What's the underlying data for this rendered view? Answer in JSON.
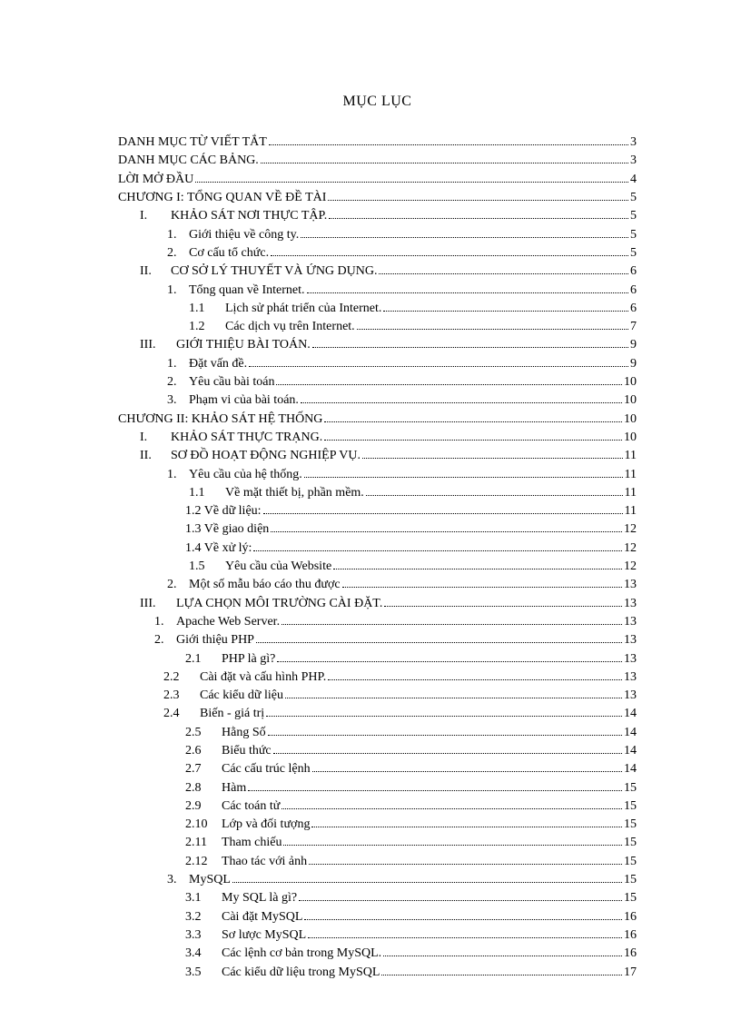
{
  "title": "MỤC LỤC",
  "entries": [
    {
      "indent": "ind0",
      "num": "",
      "text": "DANH MỤC TỪ VIẾT TẮT",
      "page": "3"
    },
    {
      "indent": "ind0",
      "num": "",
      "text": "DANH MỤC CÁC BẢNG.",
      "page": "3"
    },
    {
      "indent": "ind0",
      "num": "",
      "text": "LỜI MỞ ĐẦU",
      "page": "4"
    },
    {
      "indent": "ind0",
      "num": "",
      "text": "CHƯƠNG I: TỔNG QUAN VỀ ĐỀ TÀI",
      "page": "5"
    },
    {
      "indent": "ind1",
      "num": "I.",
      "numClass": "num-pad",
      "text": "KHẢO SÁT NƠI THỰC TẬP.",
      "page": "5"
    },
    {
      "indent": "ind2",
      "num": "1.",
      "numClass": "num-pad-s",
      "text": "Giới thiệu về công ty.",
      "page": "5"
    },
    {
      "indent": "ind2",
      "num": "2.",
      "numClass": "num-pad-s",
      "text": "Cơ cấu tổ chức.",
      "page": "5"
    },
    {
      "indent": "ind1",
      "num": "II.",
      "numClass": "num-pad",
      "text": "CƠ SỞ LÝ THUYẾT  VÀ ỨNG DỤNG.",
      "page": "6"
    },
    {
      "indent": "ind2",
      "num": "1.",
      "numClass": "num-pad-s",
      "text": "Tổng quan về Internet.",
      "page": "6"
    },
    {
      "indent": "ind3",
      "num": "1.1",
      "numClass": "num-pad-ss",
      "text": "Lịch  sử phát triển  của Internet.",
      "page": "6"
    },
    {
      "indent": "ind3",
      "num": "1.2",
      "numClass": "num-pad-ss",
      "text": "Các dịch vụ trên Internet.",
      "page": "7"
    },
    {
      "indent": "ind1",
      "num": "III.",
      "numClass": "num-pad-ss",
      "text": "GIỚI THIỆU BÀI TOÁN.",
      "page": "9"
    },
    {
      "indent": "ind2",
      "num": "1.",
      "numClass": "num-pad-s",
      "text": "Đặt vấn đề.",
      "page": "9"
    },
    {
      "indent": "ind2",
      "num": "2.",
      "numClass": "num-pad-s",
      "text": "Yêu cầu bài toán",
      "page": "10"
    },
    {
      "indent": "ind2",
      "num": "3.",
      "numClass": "num-pad-s",
      "text": "Phạm vi của bài toán.",
      "page": "10"
    },
    {
      "indent": "ind0",
      "num": "",
      "text": "CHƯƠNG II: KHẢO SÁT HỆ THỐNG",
      "page": "10"
    },
    {
      "indent": "ind1",
      "num": "I.",
      "numClass": "num-pad",
      "text": "KHẢO SÁT THỰC TRẠNG.",
      "page": "10"
    },
    {
      "indent": "ind1",
      "num": "II.",
      "numClass": "num-pad",
      "text": "SƠ ĐỒ HOẠT ĐỘNG NGHIỆP VỤ.",
      "page": "11"
    },
    {
      "indent": "ind2",
      "num": "1.",
      "numClass": "num-pad-s",
      "text": "Yêu cầu của hệ thống.",
      "page": "11"
    },
    {
      "indent": "ind3",
      "num": "1.1",
      "numClass": "num-pad-ss",
      "text": "Về mặt thiết bị, phần mềm.",
      "page": "11"
    },
    {
      "indent": "ind3b",
      "num": "",
      "text": "1.2 Về dữ liệu:",
      "page": "11"
    },
    {
      "indent": "ind3b",
      "num": "",
      "text": "1.3 Về giao diện",
      "page": "12"
    },
    {
      "indent": "ind3b",
      "num": "",
      "text": "1.4 Về xử lý:",
      "page": "12"
    },
    {
      "indent": "ind3",
      "num": "1.5",
      "numClass": "num-pad-ss",
      "text": "Yêu cầu của Website",
      "page": "12"
    },
    {
      "indent": "ind2",
      "num": "2.",
      "numClass": "num-pad-s",
      "text": "Một số mẫu báo cáo thu được",
      "page": "13"
    },
    {
      "indent": "ind1",
      "num": "III.",
      "numClass": "num-pad-ss",
      "text": "LỰA CHỌN MÔI TRƯỜNG CÀI ĐẶT.",
      "page": "13"
    },
    {
      "indent": "ind2b",
      "num": "1.",
      "numClass": "num-pad-s",
      "text": "Apache Web Server.",
      "page": "13"
    },
    {
      "indent": "ind2b",
      "num": "2.",
      "numClass": "num-pad-s",
      "text": "Giới thiệu PHP",
      "page": "13"
    },
    {
      "indent": "ind3b",
      "num": "2.1",
      "numClass": "num-pad-ss",
      "text": "PHP là gì?",
      "page": "13"
    },
    {
      "indent": "ind2c",
      "num": "2.2",
      "numClass": "num-pad-ss",
      "text": "Cài đặt và cấu hình  PHP.",
      "page": "13"
    },
    {
      "indent": "ind2c",
      "num": "2.3",
      "numClass": "num-pad-ss",
      "text": "Các kiểu  dữ liệu",
      "page": "13"
    },
    {
      "indent": "ind2c",
      "num": "2.4",
      "numClass": "num-pad-ss",
      "text": "Biến  - giá trị",
      "page": "14"
    },
    {
      "indent": "ind3b",
      "num": "2.5",
      "numClass": "num-pad-ss",
      "text": "Hằng Số",
      "page": "14"
    },
    {
      "indent": "ind3b",
      "num": "2.6",
      "numClass": "num-pad-ss",
      "text": "Biểu thức",
      "page": "14"
    },
    {
      "indent": "ind3b",
      "num": "2.7",
      "numClass": "num-pad-ss",
      "text": "Các cấu trúc lệnh",
      "page": "14"
    },
    {
      "indent": "ind3b",
      "num": "2.8",
      "numClass": "num-pad-ss",
      "text": "Hàm",
      "page": "15"
    },
    {
      "indent": "ind3b",
      "num": "2.9",
      "numClass": "num-pad-ss",
      "text": "Các toán tử",
      "page": "15"
    },
    {
      "indent": "ind3b",
      "num": "2.10",
      "numClass": "num-pad-ss",
      "text": "Lớp và đối tượng",
      "page": "15"
    },
    {
      "indent": "ind3b",
      "num": "2.11",
      "numClass": "num-pad-ss",
      "text": "Tham chiếu",
      "page": "15"
    },
    {
      "indent": "ind3b",
      "num": "2.12",
      "numClass": "num-pad-ss",
      "text": "Thao tác với ảnh",
      "page": "15"
    },
    {
      "indent": "ind2",
      "num": "3.",
      "numClass": "num-pad-s",
      "text": "MySQL",
      "page": "15"
    },
    {
      "indent": "ind3b",
      "num": "3.1",
      "numClass": "num-pad-ss",
      "text": "My SQL là gì?",
      "page": "15"
    },
    {
      "indent": "ind3b",
      "num": "3.2",
      "numClass": "num-pad-ss",
      "text": "Cài đặt MySQL",
      "page": "16"
    },
    {
      "indent": "ind3b",
      "num": "3.3",
      "numClass": "num-pad-ss",
      "text": "Sơ lược MySQL",
      "page": "16"
    },
    {
      "indent": "ind3b",
      "num": "3.4",
      "numClass": "num-pad-ss",
      "text": "Các lệnh  cơ bản trong MySQL.",
      "page": "16"
    },
    {
      "indent": "ind3b",
      "num": "3.5",
      "numClass": "num-pad-ss",
      "text": "Các kiểu dữ liệu  trong MySQL",
      "page": "17"
    }
  ]
}
